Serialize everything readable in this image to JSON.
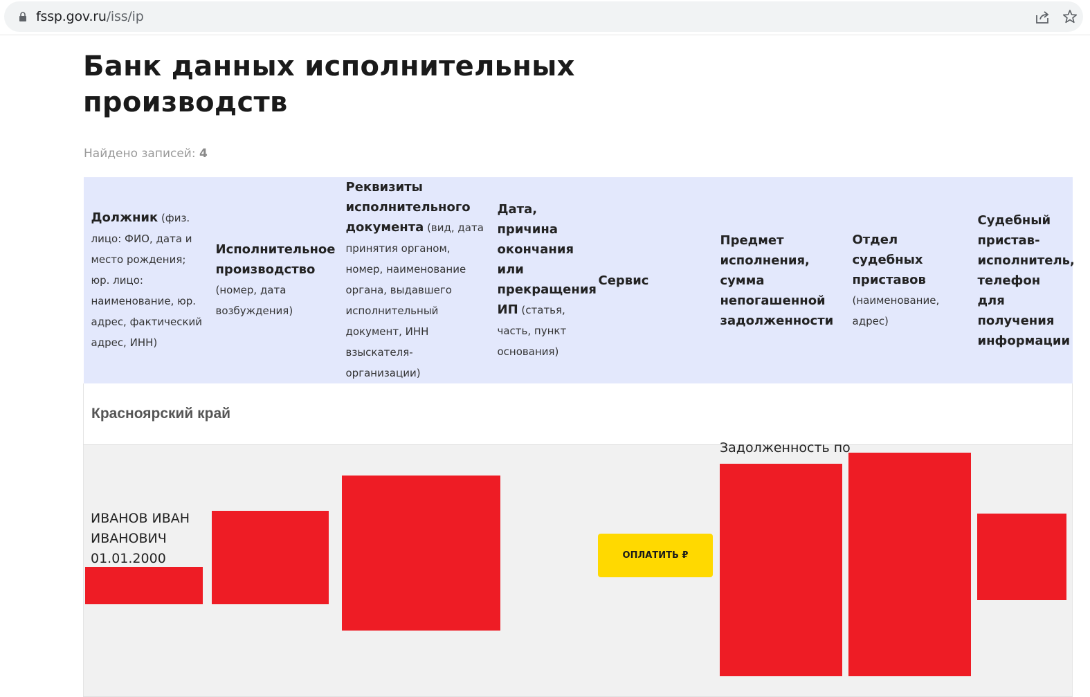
{
  "browser": {
    "url_domain": "fssp.gov.ru",
    "url_path": "/iss/ip"
  },
  "page": {
    "title": "Банк данных исполнительных производств",
    "found_label": "Найдено записей:",
    "found_count": "4"
  },
  "table": {
    "headers": [
      {
        "bold": "Должник",
        "small": " (физ. лицо: ФИО, дата и место рождения; юр. лицо: наименование, юр. адрес, фактический адрес, ИНН)"
      },
      {
        "bold": "Исполнительное производство",
        "small": "(номер, дата возбуждения)"
      },
      {
        "bold": "Реквизиты исполнительного документа",
        "small": " (вид, дата принятия органом, номер, наименование органа, выдавшего исполнительный документ, ИНН взыскателя-организации)"
      },
      {
        "bold": "Дата, причина окончания или прекращения ИП",
        "small": " (статья, часть, пункт основания)"
      },
      {
        "bold": "Сервис",
        "small": ""
      },
      {
        "bold": "Предмет исполнения, сумма непогашенной задолженности",
        "small": ""
      },
      {
        "bold": "Отдел судебных приставов",
        "small": "(наименование, адрес)"
      },
      {
        "bold": "Судебный пристав-исполнитель, телефон для получения информации",
        "small": ""
      }
    ],
    "region": "Красноярский край",
    "row": {
      "debtor_name": "ИВАНОВ ИВАН ИВАНОВИЧ",
      "debtor_birth": "01.01.2000",
      "pay_button": "ОПЛАТИТЬ ₽",
      "debt_label": "Задолженность по"
    }
  }
}
